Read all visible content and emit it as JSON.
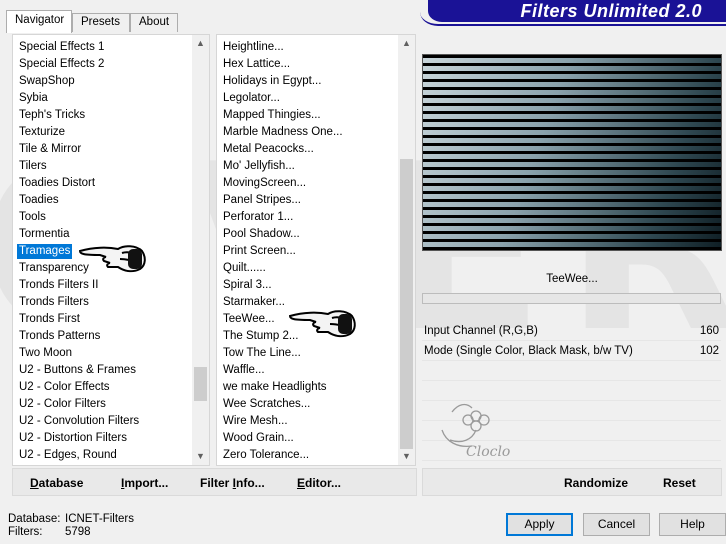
{
  "tabs": [
    "Navigator",
    "Presets",
    "About"
  ],
  "banner_title": "Filters Unlimited 2.0",
  "watermark": "OVER",
  "categories": [
    "Special Effects 1",
    "Special Effects 2",
    "SwapShop",
    "Sybia",
    "Teph's Tricks",
    "Texturize",
    "Tile & Mirror",
    "Tilers",
    "Toadies Distort",
    "Toadies",
    "Tools",
    "Tormentia",
    "Tramages",
    "Transparency",
    "Tronds Filters II",
    "Tronds Filters",
    "Tronds First",
    "Tronds Patterns",
    "Two Moon",
    "U2 - Buttons & Frames",
    "U2 - Color Effects",
    "U2 - Color Filters",
    "U2 - Convolution Filters",
    "U2 - Distortion Filters",
    "U2 - Edges, Round"
  ],
  "categories_selected_index": 12,
  "filters": [
    "Heightline...",
    "Hex Lattice...",
    "Holidays in Egypt...",
    "Legolator...",
    "Mapped Thingies...",
    "Marble Madness One...",
    "Metal Peacocks...",
    "Mo' Jellyfish...",
    "MovingScreen...",
    "Panel Stripes...",
    "Perforator 1...",
    "Pool Shadow...",
    "Print Screen...",
    "Quilt......",
    "Spiral 3...",
    "Starmaker...",
    "TeeWee...",
    "The Stump 2...",
    "Tow The Line...",
    "Waffle...",
    "we make Headlights",
    "Wee Scratches...",
    "Wire Mesh...",
    "Wood Grain...",
    "Zero Tolerance..."
  ],
  "filter_name": "TeeWee...",
  "parameters": [
    {
      "label": "Input Channel (R,G,B)",
      "value": "160"
    },
    {
      "label": "Mode (Single Color, Black Mask, b/w TV)",
      "value": "102"
    }
  ],
  "left_buttons": {
    "database": {
      "accel": "D",
      "rest": "atabase"
    },
    "import": {
      "accel": "I",
      "rest": "mport..."
    },
    "filter_info": {
      "pre": "Filter ",
      "accel": "I",
      "rest": "nfo..."
    },
    "editor": {
      "accel": "E",
      "rest": "ditor..."
    }
  },
  "right_buttons": {
    "randomize": "Randomize",
    "reset": "Reset"
  },
  "status": {
    "database_label": "Database:",
    "database_value": "ICNET-Filters",
    "filters_label": "Filters:",
    "filters_value": "5798"
  },
  "dialog_buttons": {
    "apply": "Apply",
    "cancel": "Cancel",
    "help": "Help"
  },
  "logo_text": "Cloclo"
}
